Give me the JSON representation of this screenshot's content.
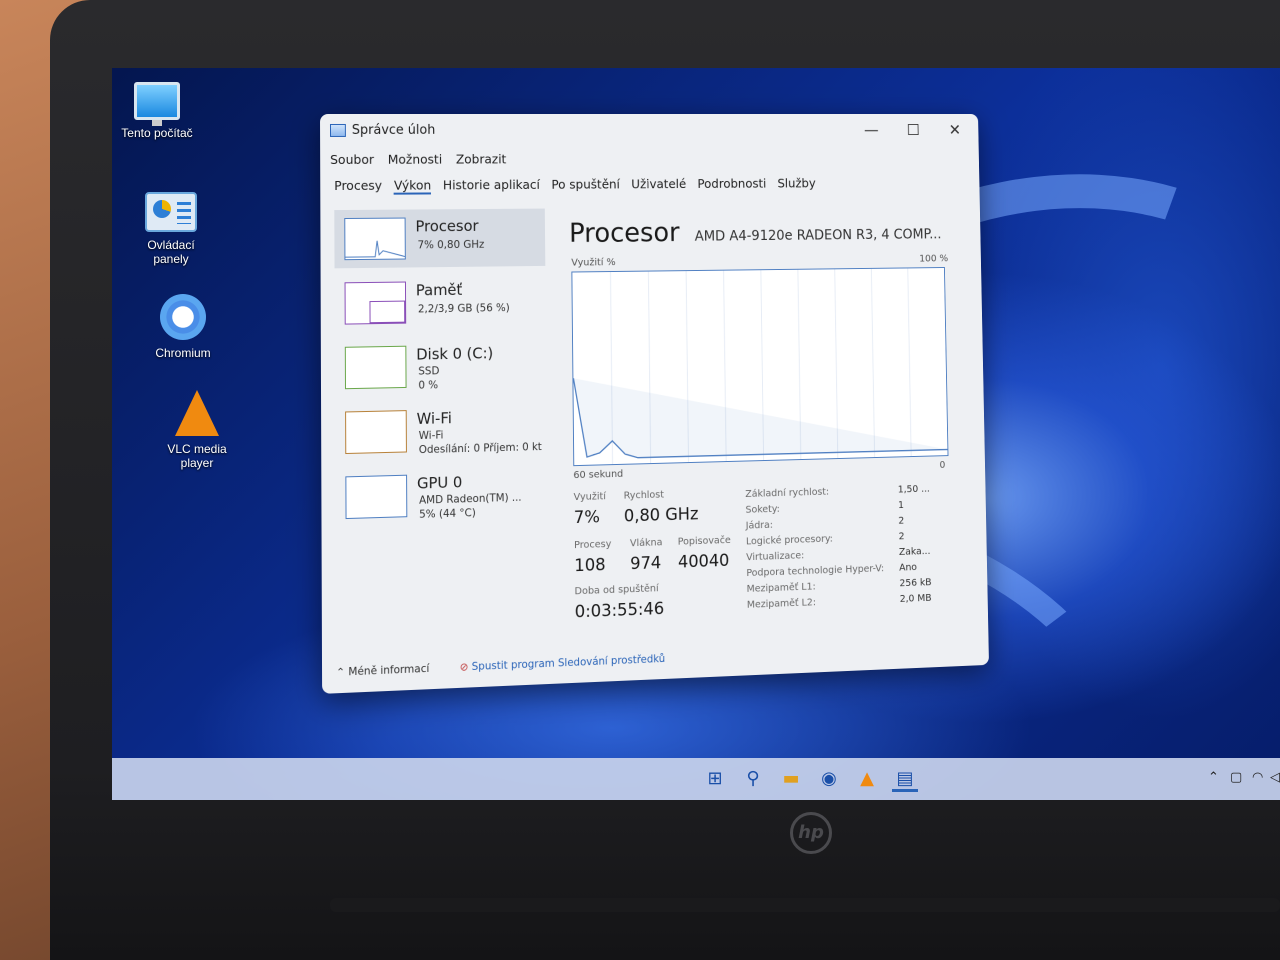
{
  "desktop": {
    "icons": [
      {
        "label": "Tento počítač",
        "icon": "computer-icon"
      },
      {
        "label": "Ovládací panely",
        "icon": "control-panel-icon"
      },
      {
        "label": "Chromium",
        "icon": "chromium-icon"
      },
      {
        "label": "VLC media player",
        "icon": "vlc-icon"
      }
    ]
  },
  "window": {
    "title": "Správce úloh",
    "controls": {
      "minimize": "—",
      "maximize": "☐",
      "close": "✕"
    }
  },
  "menu": [
    "Soubor",
    "Možnosti",
    "Zobrazit"
  ],
  "tabs": [
    {
      "label": "Procesy",
      "active": false
    },
    {
      "label": "Výkon",
      "active": true
    },
    {
      "label": "Historie aplikací",
      "active": false
    },
    {
      "label": "Po spuštění",
      "active": false
    },
    {
      "label": "Uživatelé",
      "active": false
    },
    {
      "label": "Podrobnosti",
      "active": false
    },
    {
      "label": "Služby",
      "active": false
    }
  ],
  "sidebar": [
    {
      "name": "Procesor",
      "sub1": "7% 0,80 GHz",
      "sub2": "",
      "sub3": ""
    },
    {
      "name": "Paměť",
      "sub1": "2,2/3,9 GB (56 %)",
      "sub2": "",
      "sub3": ""
    },
    {
      "name": "Disk 0 (C:)",
      "sub1": "SSD",
      "sub2": "0 %",
      "sub3": ""
    },
    {
      "name": "Wi-Fi",
      "sub1": "Wi-Fi",
      "sub2": "Odesílání: 0 Příjem: 0 kt",
      "sub3": ""
    },
    {
      "name": "GPU 0",
      "sub1": "AMD Radeon(TM) ...",
      "sub2": "5% (44 °C)",
      "sub3": ""
    }
  ],
  "main": {
    "title": "Procesor",
    "model": "AMD A4-9120e RADEON R3, 4 COMP...",
    "graph": {
      "ylabel": "Využití %",
      "ymax_label": "100 %",
      "xlabel": "60 sekund",
      "xmin_label": "0"
    },
    "stats": {
      "usage_label": "Využití",
      "usage": "7%",
      "speed_label": "Rychlost",
      "speed": "0,80 GHz",
      "processes_label": "Procesy",
      "processes": "108",
      "threads_label": "Vlákna",
      "threads": "974",
      "handles_label": "Popisovače",
      "handles": "40040",
      "uptime_label": "Doba od spuštění",
      "uptime": "0:03:55:46"
    },
    "details": [
      {
        "key": "Základní rychlost:",
        "value": "1,50 ..."
      },
      {
        "key": "Sokety:",
        "value": "1"
      },
      {
        "key": "Jádra:",
        "value": "2"
      },
      {
        "key": "Logické procesory:",
        "value": "2"
      },
      {
        "key": "Virtualizace:",
        "value": "Zaka..."
      },
      {
        "key": "Podpora technologie Hyper-V:",
        "value": "Ano"
      },
      {
        "key": "Mezipaměť L1:",
        "value": "256 kB"
      },
      {
        "key": "Mezipaměť L2:",
        "value": "2,0 MB"
      }
    ]
  },
  "chart_data": {
    "type": "line",
    "x": [
      0,
      4,
      8,
      12,
      16,
      20,
      24,
      28,
      32,
      36,
      40,
      42,
      44,
      46,
      48,
      50,
      52,
      54,
      56,
      58,
      60
    ],
    "series": [
      {
        "values": [
          3,
          3,
          3,
          3,
          3,
          3,
          3,
          3,
          3,
          3,
          3,
          3,
          3,
          3,
          3,
          3,
          5,
          12,
          6,
          4,
          45
        ]
      }
    ],
    "xlim": [
      0,
      60
    ],
    "ylim": [
      0,
      100
    ],
    "grid": false
  },
  "footer": {
    "less_info": "Méně informací",
    "resmon_link": "Spustit program Sledování prostředků"
  },
  "taskbar": {
    "icons": [
      "start-icon",
      "search-icon",
      "file-explorer-icon",
      "chromium-icon",
      "vlc-icon",
      "task-manager-icon"
    ]
  },
  "colors": {
    "accent": "#2a64b8",
    "graph_line": "#4f7fc2",
    "window_bg": "#eef0f3"
  }
}
